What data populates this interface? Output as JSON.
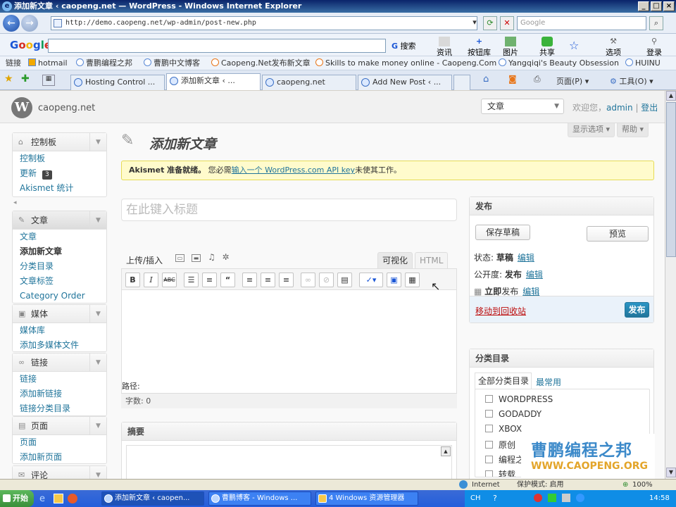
{
  "window": {
    "title": "添加新文章 ‹ caopeng.net — WordPress - Windows Internet Explorer"
  },
  "address": {
    "url": "http://demo.caopeng.net/wp-admin/post-new.php",
    "search_placeholder": "Google"
  },
  "googlebar": {
    "logo": "Google",
    "search_label": "搜索",
    "buttons": [
      "资讯",
      "按钮库",
      "图片",
      "共享",
      "选项",
      "登录"
    ]
  },
  "links": {
    "label": "链接",
    "items": [
      "hotmail",
      "曹鹏编程之邦",
      "曹鹏中文博客",
      "Caopeng.Net发布新文章",
      "Skills to make money online - Caopeng.Com",
      "Yangqiqi's Beauty Obsession",
      "HUINU"
    ]
  },
  "tabs": [
    {
      "label": "Hosting Control ..."
    },
    {
      "label": "添加新文章 ‹ ..."
    },
    {
      "label": "caopeng.net"
    },
    {
      "label": "Add New Post ‹ ..."
    }
  ],
  "commands": {
    "page": "页面(P)",
    "tools": "工具(O)"
  },
  "wp": {
    "site_name": "caopeng.net",
    "favorite_action": "文章",
    "greeting": "欢迎您，",
    "user": "admin",
    "logout": "登出",
    "screen_options": "显示选项",
    "help": "帮助"
  },
  "sidebar": {
    "dashboard": {
      "label": "控制板",
      "items": [
        "控制板",
        "更新",
        "Akismet 统计"
      ],
      "updates_count": "3"
    },
    "posts": {
      "label": "文章",
      "items": [
        "文章",
        "添加新文章",
        "分类目录",
        "文章标签",
        "Category Order"
      ]
    },
    "media": {
      "label": "媒体",
      "items": [
        "媒体库",
        "添加多媒体文件"
      ]
    },
    "links": {
      "label": "链接",
      "items": [
        "链接",
        "添加新链接",
        "链接分类目录"
      ]
    },
    "pages": {
      "label": "页面",
      "items": [
        "页面",
        "添加新页面"
      ]
    },
    "comments": {
      "label": "评论"
    }
  },
  "main": {
    "page_title": "添加新文章",
    "notice": {
      "bold": "Akismet 准备就绪。",
      "pre": "您必需",
      "link": "输入一个 WordPress.com API key",
      "post": "未使其工作。"
    },
    "title_placeholder": "在此键入标题",
    "upload_label": "上传/插入",
    "tab_visual": "可视化",
    "tab_html": "HTML",
    "path_label": "路径:",
    "word_count": "字数: 0",
    "excerpt_title": "摘要"
  },
  "publish": {
    "title": "发布",
    "save_draft": "保存草稿",
    "preview": "预览",
    "status_label": "状态:",
    "status_value": "草稿",
    "visibility_label": "公开度:",
    "visibility_value": "发布",
    "schedule_label": "立即",
    "schedule_suffix": "发布",
    "edit": "编辑",
    "trash": "移动到回收站",
    "publish_button": "发布"
  },
  "categories": {
    "title": "分类目录",
    "tab_all": "全部分类目录",
    "tab_popular": "最常用",
    "items": [
      "WORDPRESS",
      "GODADDY",
      "XBOX",
      "原创",
      "编程之",
      "转载"
    ]
  },
  "watermark": {
    "cn": "曹鹏编程之邦",
    "url": "WWW.CAOPENG.ORG"
  },
  "status": {
    "zone": "Internet",
    "protected_mode": "保护模式: 启用",
    "zoom": "100%"
  },
  "taskbar": {
    "start": "开始",
    "tasks": [
      "添加新文章 ‹ caopen...",
      "曹鹏博客 - Windows ...",
      "4 Windows 资源管理器"
    ],
    "lang": "CH",
    "time": "14:58"
  },
  "colors": {
    "wp_link": "#21759b",
    "ie_title": "#0a246a",
    "notice_bg": "#fffbcc",
    "trash": "#bc0b0b"
  }
}
